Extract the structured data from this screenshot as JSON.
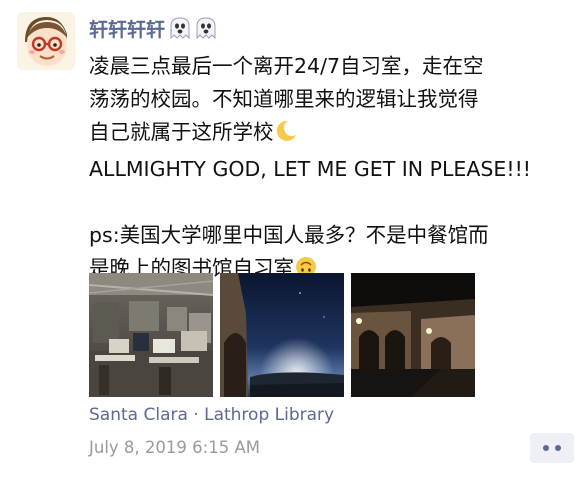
{
  "user": {
    "name": "轩轩轩轩",
    "name_emojis": [
      "ghost-emoji",
      "ghost-emoji"
    ]
  },
  "post": {
    "lines": [
      "凌晨三点最后一个离开24/7自习室，走在空",
      "荡荡的校园。不知道哪里来的逻辑让我觉得",
      "自己就属于这所学校",
      "ALLMIGHTY GOD, LET ME GET IN PLEASE!!!",
      "",
      "ps:美国大学哪里中国人最多？不是中餐馆而",
      "是晚上的图书馆自习室"
    ],
    "line3_emoji": "crescent-moon-emoji",
    "line7_emoji": "upside-down-face-emoji"
  },
  "photos": [
    {
      "label": "study-room-photo"
    },
    {
      "label": "night-campus-building-photo"
    },
    {
      "label": "night-arcade-photo"
    }
  ],
  "location": "Santa Clara · Lathrop Library",
  "timestamp": "July 8, 2019 6:15 AM",
  "colors": {
    "name": "#5b6a93",
    "link": "#5b6a93",
    "time": "#9a9a9a",
    "more_bg": "#eef0f5"
  }
}
